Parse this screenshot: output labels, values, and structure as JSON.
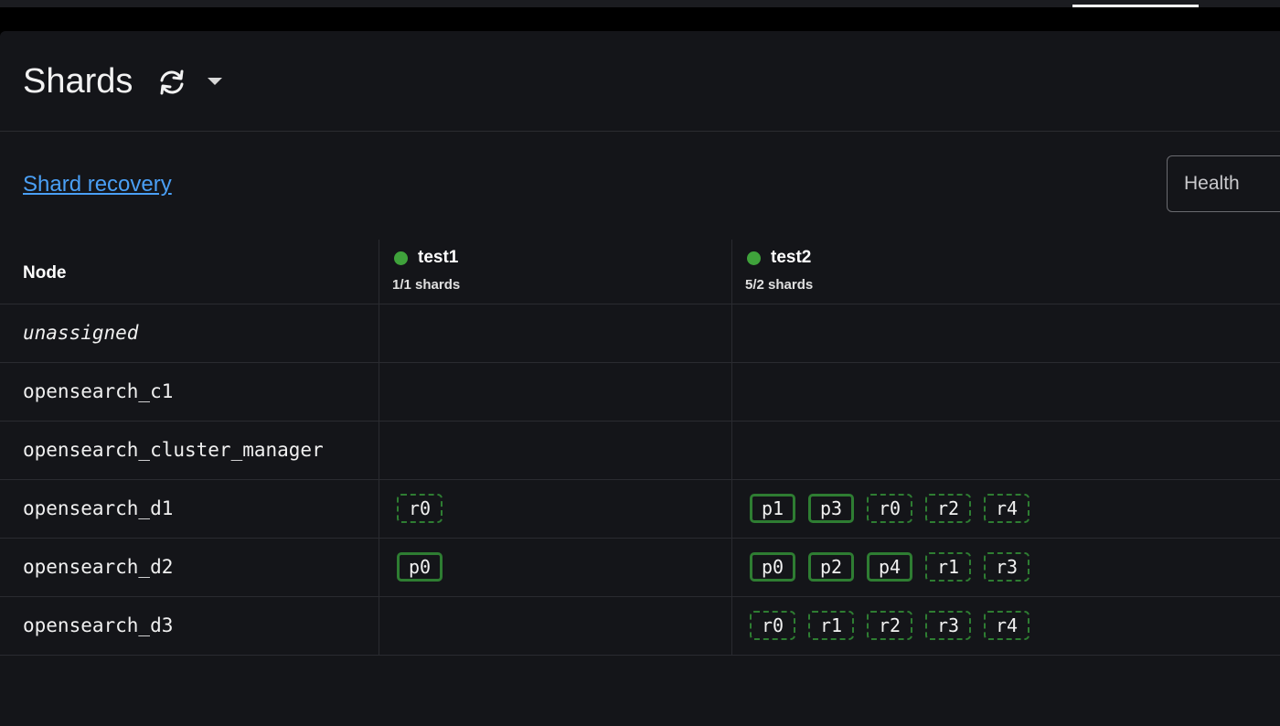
{
  "colors": {
    "background": "#141519",
    "link": "#4a9ff5",
    "health_green": "#3fa23b",
    "shard_border": "#2e7d32"
  },
  "header": {
    "title": "Shards",
    "refresh_icon": "refresh-icon",
    "dropdown_icon": "caret-down-icon"
  },
  "toolbar": {
    "recovery_link": "Shard recovery",
    "health_filter_placeholder": "Health"
  },
  "table": {
    "node_header": "Node",
    "indices": [
      {
        "name": "test1",
        "health": "green",
        "shards_summary": "1/1 shards"
      },
      {
        "name": "test2",
        "health": "green",
        "shards_summary": "5/2 shards"
      }
    ],
    "rows": [
      {
        "node": "unassigned",
        "italic": true,
        "test1": [],
        "test2": []
      },
      {
        "node": "opensearch_c1",
        "test1": [],
        "test2": []
      },
      {
        "node": "opensearch_cluster_manager",
        "test1": [],
        "test2": []
      },
      {
        "node": "opensearch_d1",
        "test1": [
          {
            "label": "r0",
            "type": "replica"
          }
        ],
        "test2": [
          {
            "label": "p1",
            "type": "primary"
          },
          {
            "label": "p3",
            "type": "primary"
          },
          {
            "label": "r0",
            "type": "replica"
          },
          {
            "label": "r2",
            "type": "replica"
          },
          {
            "label": "r4",
            "type": "replica"
          }
        ]
      },
      {
        "node": "opensearch_d2",
        "test1": [
          {
            "label": "p0",
            "type": "primary"
          }
        ],
        "test2": [
          {
            "label": "p0",
            "type": "primary"
          },
          {
            "label": "p2",
            "type": "primary"
          },
          {
            "label": "p4",
            "type": "primary"
          },
          {
            "label": "r1",
            "type": "replica"
          },
          {
            "label": "r3",
            "type": "replica"
          }
        ]
      },
      {
        "node": "opensearch_d3",
        "test1": [],
        "test2": [
          {
            "label": "r0",
            "type": "replica"
          },
          {
            "label": "r1",
            "type": "replica"
          },
          {
            "label": "r2",
            "type": "replica"
          },
          {
            "label": "r3",
            "type": "replica"
          },
          {
            "label": "r4",
            "type": "replica"
          }
        ]
      }
    ]
  }
}
